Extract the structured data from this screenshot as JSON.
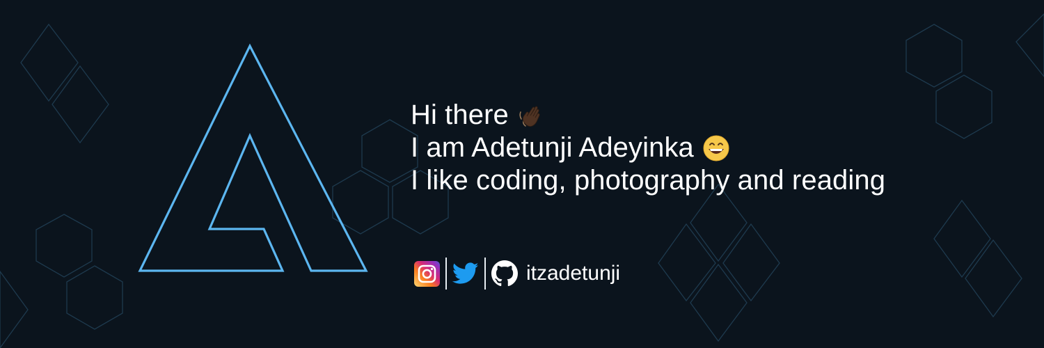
{
  "banner": {
    "greeting_line1": "Hi there",
    "greeting_line2": "I am Adetunji Adeyinka",
    "greeting_line3": "I like coding, photography and reading",
    "emoji_line1": "waving-hand-icon",
    "emoji_line2": "grinning-face-icon"
  },
  "social": {
    "icons": [
      "instagram-icon",
      "twitter-icon",
      "github-icon"
    ],
    "handle": "itzadetunji"
  },
  "colors": {
    "background": "#0b141d",
    "logo_stroke": "#5cb6f0",
    "hexagon_stroke": "#1e3a4e",
    "text": "#ffffff",
    "twitter": "#1d9bf0"
  }
}
